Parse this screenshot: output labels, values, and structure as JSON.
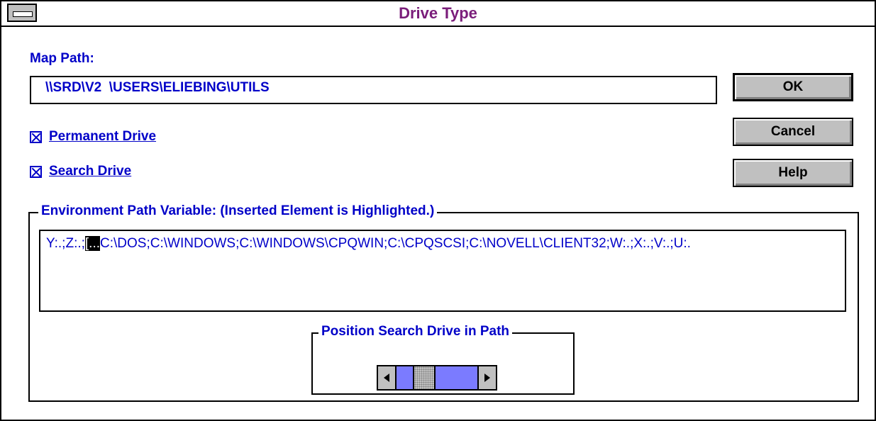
{
  "dialog": {
    "title": "Drive Type",
    "map_path": {
      "label": "Map Path:",
      "value": "\\\\SRD\\V2  \\USERS\\ELIEBING\\UTILS"
    },
    "checkboxes": [
      {
        "label": "Permanent Drive",
        "checked": true
      },
      {
        "label": "Search Drive",
        "checked": true
      }
    ],
    "buttons": {
      "ok": "OK",
      "cancel": "Cancel",
      "help": "Help"
    },
    "environment": {
      "group_label": "Environment Path Variable: (Inserted Element is Highlighted.)",
      "path_before": "Y:.;Z:.;",
      "path_highlight": "[...",
      "path_after": "C:\\DOS;C:\\WINDOWS;C:\\WINDOWS\\CPQWIN;C:\\CPQSCSI;C:\\NOVELL\\CLIENT32;W:.;X:.;V:.;U:."
    },
    "position": {
      "group_label": "Position Search Drive in Path"
    }
  },
  "icons": {
    "system_menu": "system-menu-icon",
    "scroll_left": "scroll-left-arrow-icon",
    "scroll_right": "scroll-right-arrow-icon"
  },
  "colors": {
    "title": "#7a1d7a",
    "text": "#0000c8",
    "button": "#c0c0c0",
    "scroll_track": "#7b7bff"
  }
}
